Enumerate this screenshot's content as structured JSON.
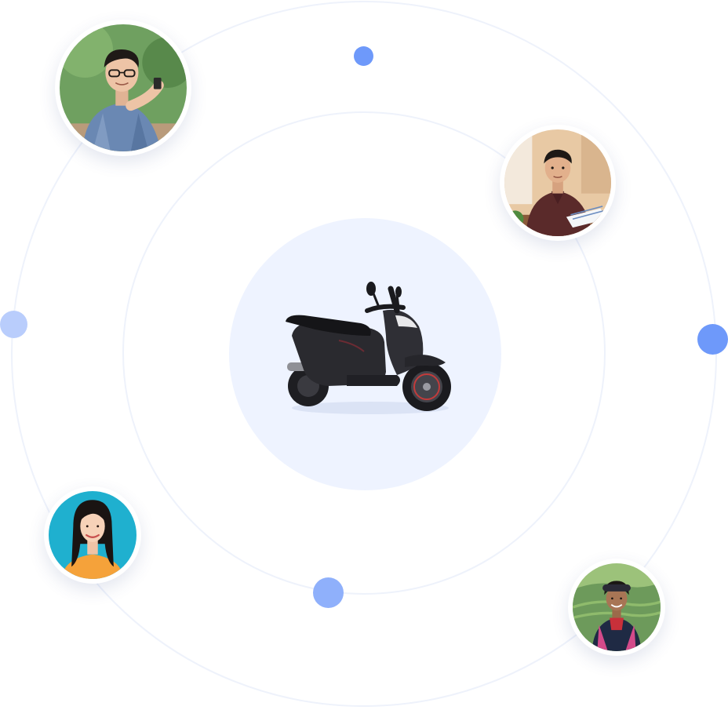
{
  "colors": {
    "orbit_line": "#eef2fb",
    "core_background": "#eef3ff",
    "dot_strong": "#6e99fa",
    "dot_medium": "#8fb0fb",
    "dot_light": "#b9cdfc",
    "avatar_ring": "#ffffff"
  },
  "orbit_dots": [
    {
      "name": "top",
      "tone": "strong"
    },
    {
      "name": "left",
      "tone": "light"
    },
    {
      "name": "right",
      "tone": "strong"
    },
    {
      "name": "bottom",
      "tone": "medium"
    }
  ],
  "center": {
    "icon": "scooter-icon"
  },
  "avatars": [
    {
      "name": "man-with-glasses-phone",
      "background": "#6fa060"
    },
    {
      "name": "man-office-papers",
      "background": "#e8c9a4"
    },
    {
      "name": "woman-smiling-orange",
      "background": "#1fb0cf"
    },
    {
      "name": "woman-traditional-dress",
      "background": "#6d9a5b"
    }
  ]
}
